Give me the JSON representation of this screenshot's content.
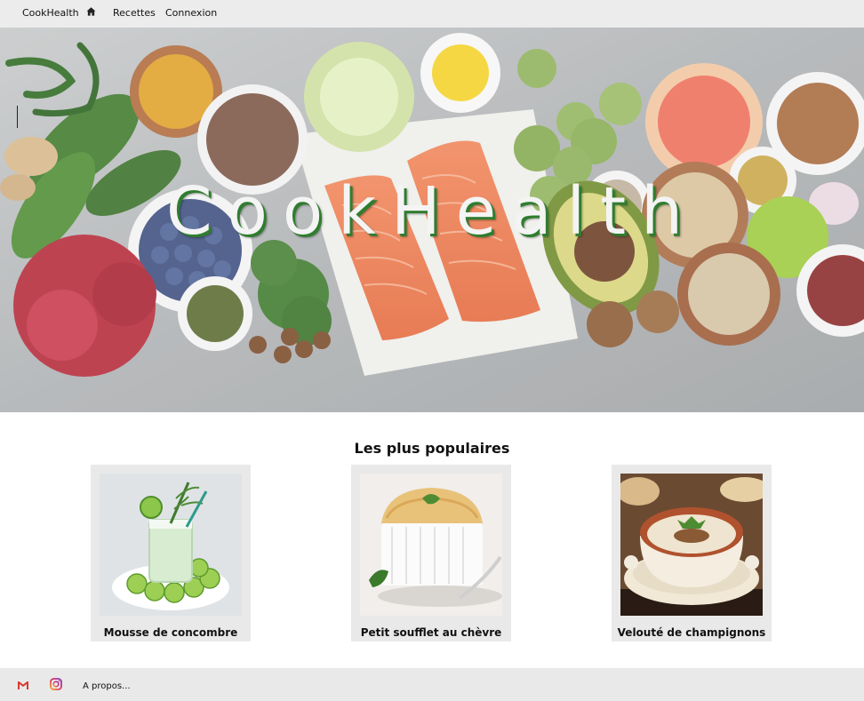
{
  "nav": {
    "brand": "CookHealth",
    "home_icon": "home-icon",
    "recipes": "Recettes",
    "login": "Connexion"
  },
  "hero": {
    "title": "CookHealth"
  },
  "popular": {
    "title": "Les plus populaires",
    "cards": [
      {
        "label": "Mousse de concombre"
      },
      {
        "label": "Petit soufflet au chèvre"
      },
      {
        "label": "Velouté de champignons"
      }
    ]
  },
  "footer": {
    "mail_icon": "gmail-icon",
    "instagram_icon": "instagram-icon",
    "about": "A propos..."
  },
  "colors": {
    "nav_bg": "#ececec",
    "title_shadow": "#2f7d2f",
    "card_bg": "#e9e9e9",
    "footer_bg": "#e9e9e9"
  }
}
